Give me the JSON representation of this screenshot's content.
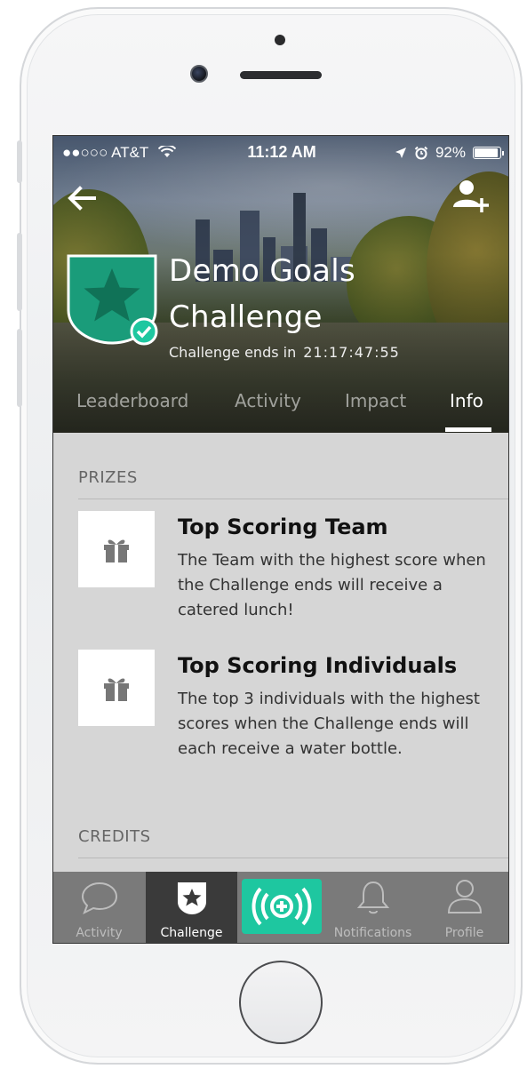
{
  "status_bar": {
    "carrier": "●●○○○ AT&T",
    "time": "11:12 AM",
    "battery": "92%"
  },
  "header": {
    "title": "Demo Goals Challenge",
    "title_line1": "Demo Goals",
    "title_line2": "Challenge",
    "ends_label": "Challenge ends in",
    "countdown": "21:17:47:55"
  },
  "tabs": [
    {
      "label": "Leaderboard",
      "active": false
    },
    {
      "label": "Activity",
      "active": false
    },
    {
      "label": "Impact",
      "active": false
    },
    {
      "label": "Info",
      "active": true
    }
  ],
  "sections": {
    "prizes_heading": "PRIZES",
    "credits_heading": "CREDITS"
  },
  "prizes": [
    {
      "title": "Top Scoring Team",
      "description": "The Team with the highest score when the Challenge ends will receive a catered lunch!"
    },
    {
      "title": "Top Scoring Individuals",
      "description": "The top 3 individuals with the highest scores when the Challenge ends will each receive a water bottle."
    }
  ],
  "tab_bar": [
    {
      "label": "Activity",
      "icon": "speech-bubble-icon",
      "active": false
    },
    {
      "label": "Challenge",
      "icon": "star-shield-icon",
      "active": true
    },
    {
      "label": "",
      "icon": "log-activity-plus-icon",
      "active": false
    },
    {
      "label": "Notifications",
      "icon": "bell-icon",
      "active": false
    },
    {
      "label": "Profile",
      "icon": "person-icon",
      "active": false
    }
  ],
  "colors": {
    "accent": "#1ec7a0",
    "badge_green": "#1a9c7a",
    "content_bg": "#d6d6d6",
    "tabbar_bg": "#7a7a7a",
    "tabbar_active": "#3a3a3a"
  }
}
